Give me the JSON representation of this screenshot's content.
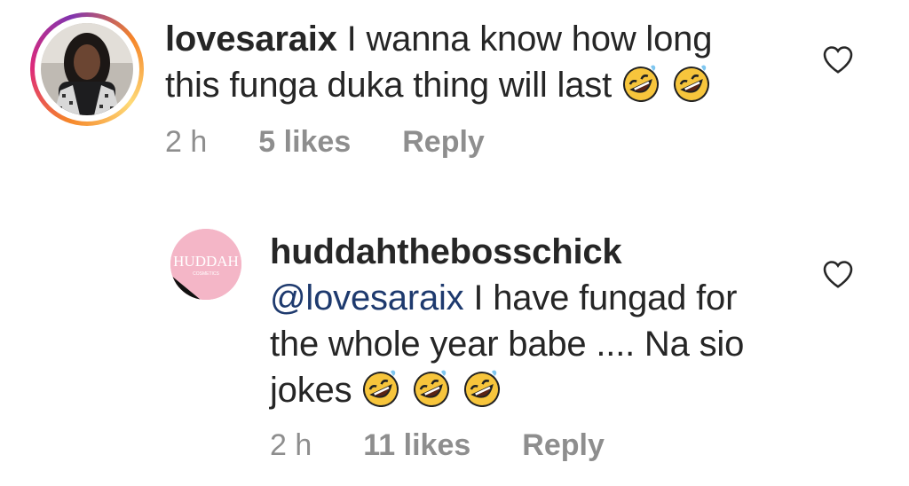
{
  "comments": [
    {
      "username": "lovesaraix",
      "mention": "",
      "text_line1": "I wanna know how long",
      "text_line2": "this funga duka thing will last",
      "emojis": [
        "rolling-on-floor-laughing-emoji",
        "rolling-on-floor-laughing-emoji"
      ],
      "time": "2 h",
      "likes": "5 likes",
      "reply_label": "Reply"
    },
    {
      "username": "huddahthebosschick",
      "mention": "@lovesaraix",
      "text_line1": "I have fungad for",
      "text_line2": "the whole year babe .... Na sio",
      "text_line3": "jokes",
      "emojis": [
        "rolling-on-floor-laughing-emoji",
        "rolling-on-floor-laughing-emoji",
        "rolling-on-floor-laughing-emoji"
      ],
      "avatar_text": "HUDDAH",
      "avatar_subtext": "COSMETICS",
      "time": "2 h",
      "likes": "11 likes",
      "reply_label": "Reply"
    }
  ],
  "colors": {
    "text": "#262626",
    "meta": "#8e8e8e",
    "mention": "#1e3a6e",
    "avatar_pink": "#f4b6c7"
  },
  "icons": {
    "like": "heart-outline-icon",
    "emoji": "rolling-on-floor-laughing-emoji"
  }
}
